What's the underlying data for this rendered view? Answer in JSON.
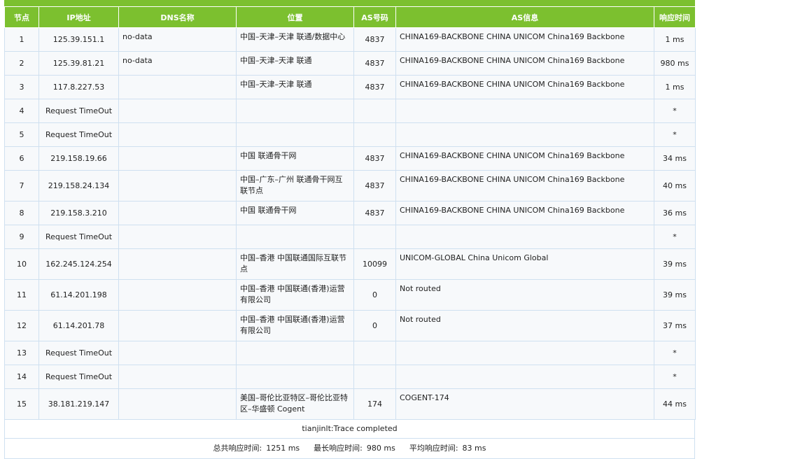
{
  "headers": [
    "节点",
    "IP地址",
    "DNS名称",
    "位置",
    "AS号码",
    "AS信息",
    "响应时间"
  ],
  "rows": [
    {
      "node": "1",
      "ip": "125.39.151.1",
      "dns": "no-data",
      "loc": "中国–天津–天津 联通/数据中心",
      "as": "4837",
      "asinfo": "CHINA169-BACKBONE CHINA UNICOM China169 Backbone",
      "ms": "1 ms",
      "tall": false
    },
    {
      "node": "2",
      "ip": "125.39.81.21",
      "dns": "no-data",
      "loc": "中国–天津–天津 联通",
      "as": "4837",
      "asinfo": "CHINA169-BACKBONE CHINA UNICOM China169 Backbone",
      "ms": "980 ms",
      "tall": false
    },
    {
      "node": "3",
      "ip": "117.8.227.53",
      "dns": "",
      "loc": "中国–天津–天津 联通",
      "as": "4837",
      "asinfo": "CHINA169-BACKBONE CHINA UNICOM China169 Backbone",
      "ms": "1 ms",
      "tall": false
    },
    {
      "node": "4",
      "ip": "Request TimeOut",
      "dns": "",
      "loc": "",
      "as": "",
      "asinfo": "",
      "ms": "*",
      "tall": false
    },
    {
      "node": "5",
      "ip": "Request TimeOut",
      "dns": "",
      "loc": "",
      "as": "",
      "asinfo": "",
      "ms": "*",
      "tall": false
    },
    {
      "node": "6",
      "ip": "219.158.19.66",
      "dns": "",
      "loc": "中国 联通骨干网",
      "as": "4837",
      "asinfo": "CHINA169-BACKBONE CHINA UNICOM China169 Backbone",
      "ms": "34 ms",
      "tall": false
    },
    {
      "node": "7",
      "ip": "219.158.24.134",
      "dns": "",
      "loc": "中国–广东–广州 联通骨干网互联节点",
      "as": "4837",
      "asinfo": "CHINA169-BACKBONE CHINA UNICOM China169 Backbone",
      "ms": "40 ms",
      "tall": true
    },
    {
      "node": "8",
      "ip": "219.158.3.210",
      "dns": "",
      "loc": "中国 联通骨干网",
      "as": "4837",
      "asinfo": "CHINA169-BACKBONE CHINA UNICOM China169 Backbone",
      "ms": "36 ms",
      "tall": false
    },
    {
      "node": "9",
      "ip": "Request TimeOut",
      "dns": "",
      "loc": "",
      "as": "",
      "asinfo": "",
      "ms": "*",
      "tall": false
    },
    {
      "node": "10",
      "ip": "162.245.124.254",
      "dns": "",
      "loc": "中国–香港 中国联通国际互联节点",
      "as": "10099",
      "asinfo": "UNICOM-GLOBAL China Unicom Global",
      "ms": "39 ms",
      "tall": true
    },
    {
      "node": "11",
      "ip": "61.14.201.198",
      "dns": "",
      "loc": "中国–香港 中国联通(香港)运营有限公司",
      "as": "0",
      "asinfo": "Not routed",
      "ms": "39 ms",
      "tall": true
    },
    {
      "node": "12",
      "ip": "61.14.201.78",
      "dns": "",
      "loc": "中国–香港 中国联通(香港)运营有限公司",
      "as": "0",
      "asinfo": "Not routed",
      "ms": "37 ms",
      "tall": true
    },
    {
      "node": "13",
      "ip": "Request TimeOut",
      "dns": "",
      "loc": "",
      "as": "",
      "asinfo": "",
      "ms": "*",
      "tall": false
    },
    {
      "node": "14",
      "ip": "Request TimeOut",
      "dns": "",
      "loc": "",
      "as": "",
      "asinfo": "",
      "ms": "*",
      "tall": false
    },
    {
      "node": "15",
      "ip": "38.181.219.147",
      "dns": "",
      "loc": "美国–哥伦比亚特区–哥伦比亚特区–华盛顿 Cogent",
      "as": "174",
      "asinfo": "COGENT-174",
      "ms": "44 ms",
      "tall": true
    }
  ],
  "footer": {
    "trace_status": "tianjinlt:Trace completed",
    "total_label": "总共响应时间:",
    "total_value": "1251 ms",
    "max_label": "最长响应时间:",
    "max_value": "980 ms",
    "avg_label": "平均响应时间:",
    "avg_value": "83 ms"
  },
  "colors": {
    "header_bg": "#7cc02f",
    "border": "#cfe0f0",
    "row_bg": "#f7f9fb"
  }
}
